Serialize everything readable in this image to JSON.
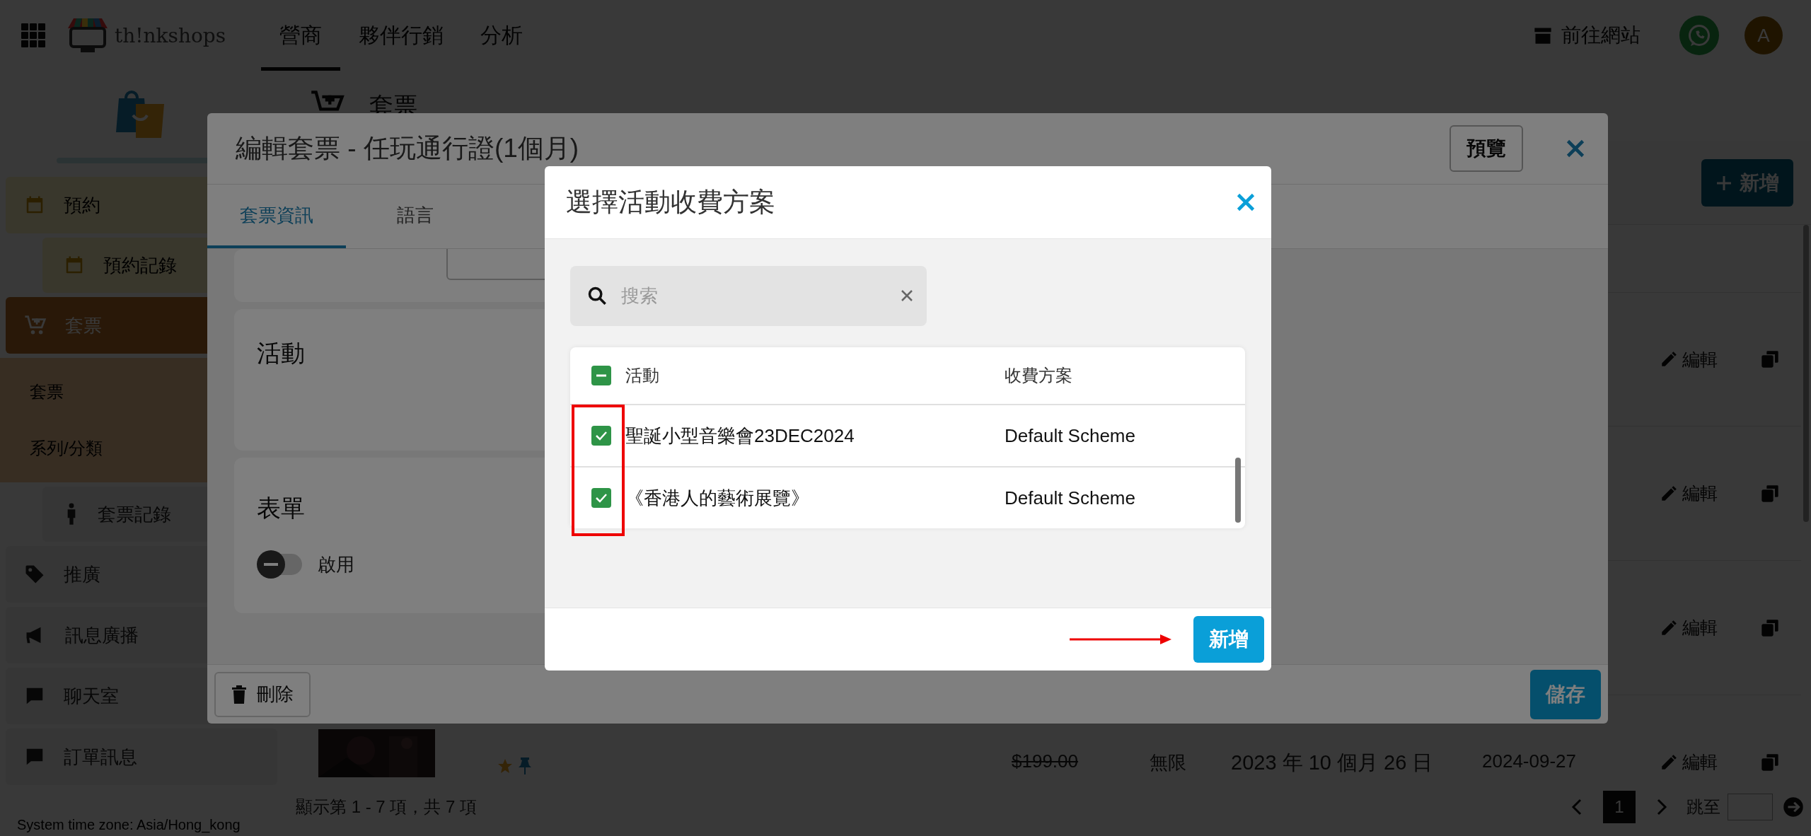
{
  "topbar": {
    "brand": "th!nkshops",
    "nav": [
      {
        "label": "營商",
        "selected": true
      },
      {
        "label": "夥伴行銷",
        "selected": false
      },
      {
        "label": "分析",
        "selected": false
      }
    ],
    "site_link": "前往網站",
    "avatar": "A"
  },
  "sidebar": {
    "items": [
      {
        "label": "預約",
        "selected": false,
        "children": [
          {
            "label": "預約記錄",
            "kind": "boxed",
            "selected": false
          }
        ]
      },
      {
        "label": "套票",
        "selected": true,
        "children": [
          {
            "label": "套票",
            "kind": "plain",
            "selected": false
          },
          {
            "label": "系列/分類",
            "kind": "plain",
            "selected": false
          },
          {
            "label": "套票記錄",
            "kind": "boxed",
            "selected": false
          }
        ]
      },
      {
        "label": "推廣",
        "selected": false
      },
      {
        "label": "訊息廣播",
        "selected": false
      },
      {
        "label": "聊天室",
        "selected": false
      },
      {
        "label": "訂單訊息",
        "selected": false
      }
    ],
    "timezone": "System time zone: Asia/Hong_kong"
  },
  "page": {
    "title": "套票",
    "add_button": "新增",
    "rows": [
      {
        "action": "編輯"
      },
      {
        "action": "編輯"
      },
      {
        "action": "編輯"
      },
      {
        "action": "編輯",
        "original_price": "$199.00",
        "quota": "無限",
        "validity": "2023 年 10 個月 26 日",
        "created": "2024-09-27"
      }
    ],
    "pagination": {
      "summary": "顯示第 1 - 7 項，共 7 項",
      "page": "1",
      "jump_label": "跳至"
    }
  },
  "edit_dialog": {
    "title": "編輯套票 - 任玩通行證(1個月)",
    "preview_button": "預覽",
    "tabs": [
      {
        "label": "套票資訊",
        "selected": true
      },
      {
        "label": "語言",
        "selected": false
      }
    ],
    "sections": [
      {
        "title": "活動"
      },
      {
        "title": "表單",
        "toggle": {
          "label": "啟用",
          "on": false
        }
      }
    ],
    "delete_button": "刪除",
    "save_button": "儲存"
  },
  "picker_dialog": {
    "title": "選擇活動收費方案",
    "search": {
      "placeholder": "搜索"
    },
    "select_all": {
      "indeterminate": true
    },
    "columns": [
      "活動",
      "收費方案"
    ],
    "rows": [
      {
        "activity": "聖誕小型音樂會23DEC2024",
        "scheme": "Default Scheme",
        "checked": true
      },
      {
        "activity": "《香港人的藝術展覽》",
        "scheme": "Default Scheme",
        "checked": true
      }
    ],
    "add_button": "新增"
  }
}
